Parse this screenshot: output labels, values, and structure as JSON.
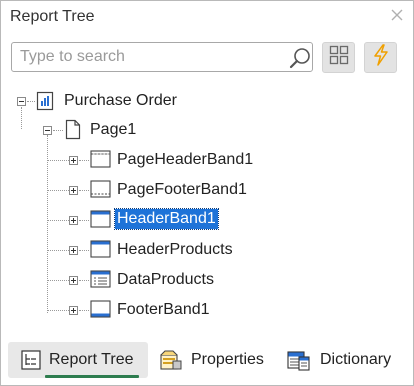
{
  "panel": {
    "title": "Report Tree",
    "close_icon": "close-icon"
  },
  "search": {
    "placeholder": "Type to search",
    "value": "",
    "search_icon": "search-icon"
  },
  "toolbar": {
    "expand_icon": "grid-icon",
    "quick_icon": "lightning-icon"
  },
  "tree": {
    "root": {
      "label": "Purchase Order",
      "expanded": true,
      "icon": "report-icon"
    },
    "page": {
      "label": "Page1",
      "expanded": true,
      "icon": "page-icon"
    },
    "bands": [
      {
        "label": "PageHeaderBand1",
        "icon": "page-header-band-icon",
        "selected": false
      },
      {
        "label": "PageFooterBand1",
        "icon": "page-footer-band-icon",
        "selected": false
      },
      {
        "label": "HeaderBand1",
        "icon": "header-band-icon",
        "selected": true
      },
      {
        "label": "HeaderProducts",
        "icon": "header-band-icon",
        "selected": false
      },
      {
        "label": "DataProducts",
        "icon": "data-band-icon",
        "selected": false
      },
      {
        "label": "FooterBand1",
        "icon": "footer-band-icon",
        "selected": false
      }
    ]
  },
  "tabs": [
    {
      "label": "Report Tree",
      "icon": "report-tree-icon",
      "active": true
    },
    {
      "label": "Properties",
      "icon": "properties-icon",
      "active": false
    },
    {
      "label": "Dictionary",
      "icon": "dictionary-icon",
      "active": false
    }
  ],
  "colors": {
    "selection": "#1e73d8",
    "active_tab_underline": "#2e7d4f",
    "quick_icon": "#f0a000"
  }
}
